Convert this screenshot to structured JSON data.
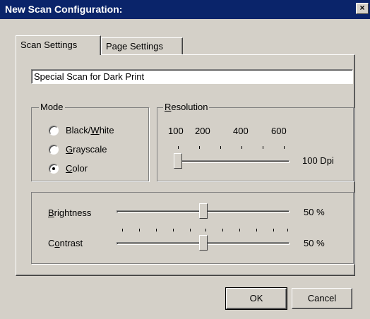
{
  "window": {
    "title": "New Scan Configuration:",
    "close_symbol": "×"
  },
  "tabs": [
    {
      "label": "Scan Settings",
      "active": true
    },
    {
      "label": "Page Settings",
      "active": false
    }
  ],
  "scan_name": {
    "value": "Special Scan for Dark Print"
  },
  "mode": {
    "legend": "Mode",
    "options": [
      {
        "pre": "Black/",
        "u": "W",
        "post": "hite",
        "selected": false
      },
      {
        "pre": "",
        "u": "G",
        "post": "rayscale",
        "selected": false
      },
      {
        "pre": "",
        "u": "C",
        "post": "olor",
        "selected": true
      }
    ]
  },
  "resolution": {
    "legend_u": "R",
    "legend_rest": "esolution",
    "tick_labels": [
      "100",
      "200",
      "400",
      "600"
    ],
    "value": 100,
    "value_label": "100 Dpi"
  },
  "brightness": {
    "label_u": "B",
    "label_rest": "rightness",
    "value": 50,
    "value_label": "50 %"
  },
  "contrast": {
    "label_pre": "C",
    "label_u": "o",
    "label_rest": "ntrast",
    "value": 50,
    "value_label": "50 %"
  },
  "buttons": {
    "ok": "OK",
    "cancel": "Cancel"
  }
}
